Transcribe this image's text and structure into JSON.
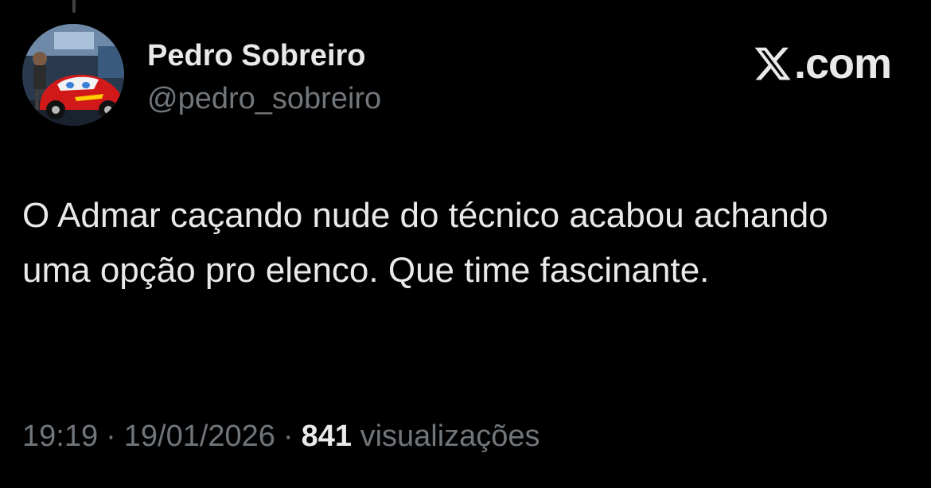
{
  "tweet": {
    "author": {
      "display_name": "Pedro Sobreiro",
      "handle": "@pedro_sobreiro",
      "avatar_icon": "avatar-photo-red-race-car"
    },
    "brand": {
      "icon": "x-logo-icon",
      "text": ".com"
    },
    "text": "O Admar caçando nude do técnico acabou achando uma opção pro elenco. Que time fascinante.",
    "meta": {
      "time": "19:19",
      "separator": "·",
      "date": "19/01/2026",
      "views_count": "841",
      "views_label": "visualizações"
    }
  },
  "colors": {
    "background": "#000000",
    "primary_text": "#e7e9ea",
    "secondary_text": "#71767b",
    "thread_line": "#3e4144"
  }
}
